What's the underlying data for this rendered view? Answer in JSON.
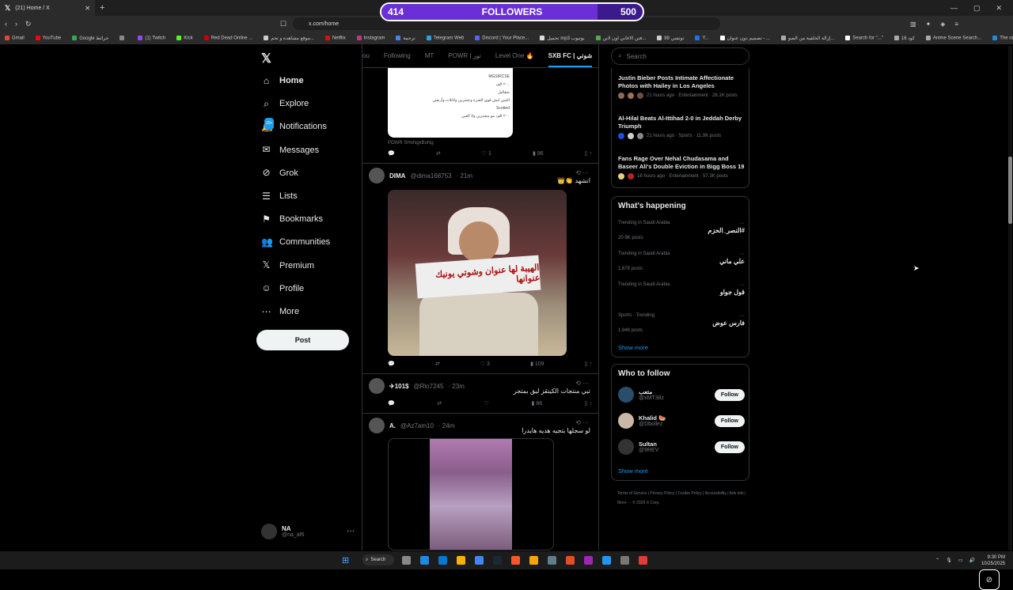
{
  "browser": {
    "tab_title": "(21) Home / X",
    "url": "x.com/home",
    "bookmarks": [
      "Gmail",
      "YouTube",
      "Google خرائط",
      "",
      "(1) Twitch",
      "Kick",
      "Red Dead Online ...",
      "موقع مشاهدة و تحم...",
      "Netflix",
      "Instagram",
      "ترجمة",
      "Telegram Web",
      "Discord | Your Place...",
      "تحميل mp3 يوتيوب",
      "فتن الاغاني اون لاين...",
      "توتشي 99",
      "Y...",
      "تصميم دون عنوان - ...",
      "إزالة الخلفية من الصو...",
      "Search for \"...\"",
      "كود 16",
      "Anime Scene Search...",
      "The online code edi..."
    ]
  },
  "overlay": {
    "current": "414",
    "label": "FOLLOWERS",
    "goal": "500",
    "progress": 0.828
  },
  "nav": {
    "items": [
      {
        "label": "Home",
        "icon": "home-icon",
        "active": true
      },
      {
        "label": "Explore",
        "icon": "search-icon"
      },
      {
        "label": "Notifications",
        "icon": "bell-icon",
        "badge": "20+"
      },
      {
        "label": "Messages",
        "icon": "mail-icon"
      },
      {
        "label": "Grok",
        "icon": "grok-icon"
      },
      {
        "label": "Lists",
        "icon": "list-icon"
      },
      {
        "label": "Bookmarks",
        "icon": "bookmark-icon"
      },
      {
        "label": "Communities",
        "icon": "communities-icon"
      },
      {
        "label": "Premium",
        "icon": "x-icon"
      },
      {
        "label": "Profile",
        "icon": "person-icon"
      },
      {
        "label": "More",
        "icon": "more-icon"
      }
    ],
    "post_label": "Post",
    "profile": {
      "name": "NA",
      "handle": "@na_af6"
    }
  },
  "timeline": {
    "tabs": [
      "ou",
      "Following",
      "MT",
      "POWR | تور",
      "Level One 🔥",
      "SXB FC | شوتي"
    ],
    "card_link": "POWR SHoNgxBoNg",
    "card_lines": [
      "MGSIRCSE",
      "٢٠٠ الف",
      "شقاليل",
      "الحين ايش قوي الفترة وعشرين ولاثلاث وأربعين",
      "Scotted",
      "٢٠٠ الف مو مشترين ولا الفين"
    ],
    "post1_actions": {
      "reply": "",
      "retweet": "",
      "like": "1",
      "views": "96"
    },
    "tweet2": {
      "name": "DIMA",
      "handle": "@dima168753",
      "time": "· 21m",
      "text": "انشهد 👏👑",
      "sign": "الهيبة لها عنوان وشوتي يونيك عنوانها",
      "actions": {
        "reply": "",
        "retweet": "",
        "like": "3",
        "views": "109"
      }
    },
    "tweet3": {
      "name": "✈101$",
      "handle": "@Rlo7245",
      "time": "· 23m",
      "text": "تبي منتجات الكيتقز ليق بمتجر",
      "actions": {
        "reply": "",
        "retweet": "",
        "like": "",
        "views": "86"
      }
    },
    "tweet4": {
      "name": "A.",
      "handle": "@Az7am10",
      "time": "· 24m",
      "text": "لو سجلها بتجيه هديه هايدرا"
    }
  },
  "right": {
    "search_placeholder": "Search",
    "news": [
      {
        "title": "Justin Bieber Posts Intimate Affectionate Photos with Hailey in Los Angeles",
        "meta": "21 hours ago · Entertainment · 28.1K posts"
      },
      {
        "title": "Al-Hilal Beats Al-Ittihad 2-0 in Jeddah Derby Triumph",
        "meta": "21 hours ago · Sports · 11.9K posts"
      },
      {
        "title": "Fans Rage Over Nehal Chudasama and Baseer Ali's Double Eviction in Bigg Boss 19",
        "meta": "18 hours ago · Entertainment · 57.3K posts"
      }
    ],
    "happening_title": "What's happening",
    "trends": [
      {
        "context": "Trending in Saudi Arabia",
        "name": "#النصر_الحزم",
        "count": "20.9K posts"
      },
      {
        "context": "Trending in Saudi Arabia",
        "name": "علي ماني",
        "count": "1,678 posts"
      },
      {
        "context": "Trending in Saudi Arabia",
        "name": "قول جواو",
        "count": ""
      },
      {
        "context": "Sports · Trending",
        "name": "فارس عوض",
        "count": "1,946 posts"
      }
    ],
    "show_more": "Show more",
    "wtf_title": "Who to follow",
    "follow": [
      {
        "name": "متعب",
        "handle": "@xMT38z",
        "btn": "Follow"
      },
      {
        "name": "Khalid 🍉",
        "handle": "@Dbollez",
        "btn": "Follow"
      },
      {
        "name": "Sultan",
        "handle": "@9REV",
        "btn": "Follow"
      }
    ],
    "footer": "Terms of Service  |  Privacy Policy  |  Cookie Policy  |  Accessibility  |  Ads info  |  More ···  © 2025 X Corp."
  },
  "taskbar": {
    "search": "Search",
    "time": "9:30 PM",
    "date": "10/25/2025"
  },
  "colors": {
    "accent": "#1d9bf0",
    "overlay_bg": "#3c1a8e"
  }
}
